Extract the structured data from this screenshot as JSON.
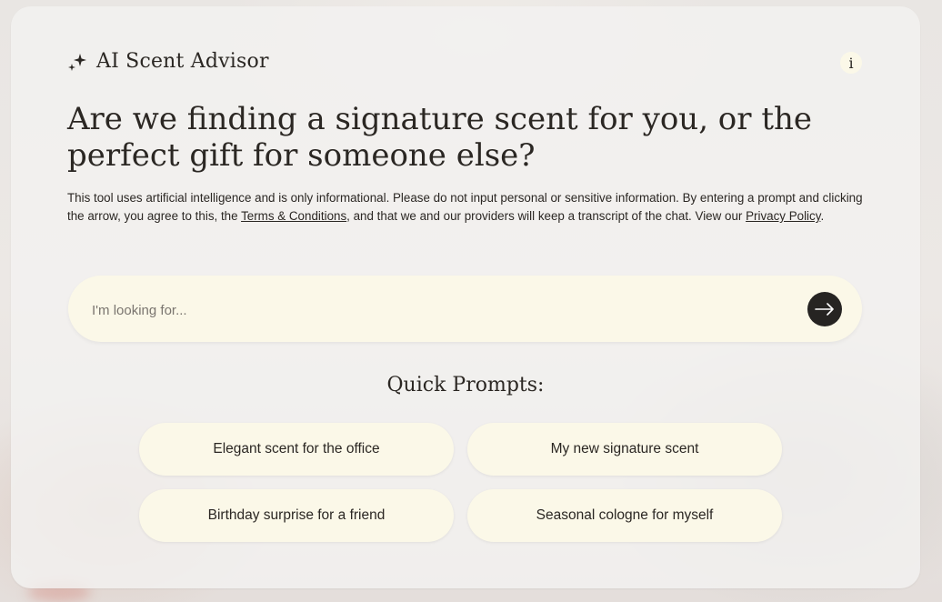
{
  "header": {
    "title": "AI Scent Advisor",
    "info_label": "i"
  },
  "main": {
    "headline": "Are we finding a signature scent for you, or the perfect gift for someone else?",
    "disclaimer": {
      "part1": "This tool uses artificial intelligence and is only informational. Please do not input personal or sensitive information. By entering a prompt and clicking the arrow, you agree to this, the ",
      "terms_link": "Terms & Conditions",
      "part2": ", and that we and our providers will keep a transcript of the chat. View our ",
      "privacy_link": "Privacy Policy",
      "part3": "."
    }
  },
  "search": {
    "value": "",
    "placeholder": "I'm looking for..."
  },
  "quick_prompts": {
    "title": "Quick Prompts:",
    "items": [
      {
        "label": "Elegant scent for the office"
      },
      {
        "label": "My new signature scent"
      },
      {
        "label": "Birthday surprise for a friend"
      },
      {
        "label": "Seasonal cologne for myself"
      }
    ]
  },
  "icons": {
    "brand": "sparkle-icon",
    "submit": "arrow-right-icon",
    "info": "info-icon"
  },
  "colors": {
    "panel": "#f3f1f0",
    "cream": "#fbf8e8",
    "button_dark": "#262422",
    "text": "#2b2723"
  }
}
